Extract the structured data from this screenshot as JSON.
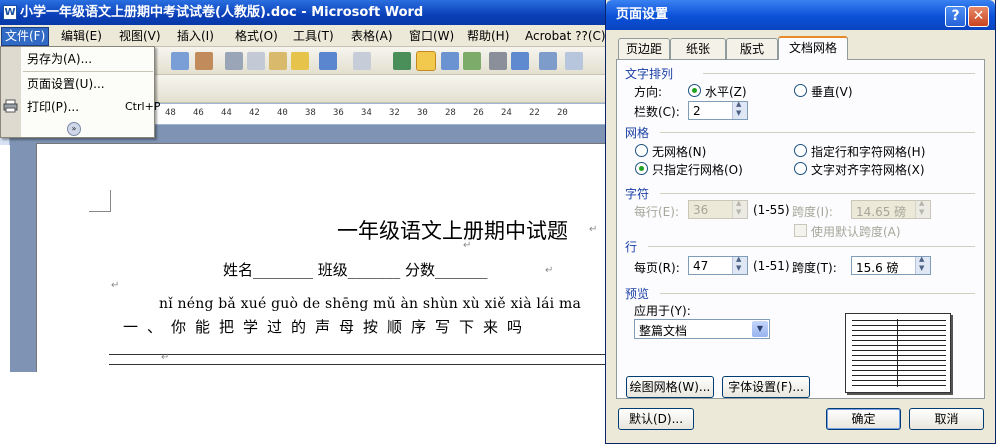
{
  "word": {
    "title": "小学一年级语文上册期中考试试卷(人教版).doc - Microsoft Word",
    "menus": [
      "文件(F)",
      "编辑(E)",
      "视图(V)",
      "插入(I)",
      "格式(O)",
      "工具(T)",
      "表格(A)",
      "窗口(W)",
      "帮助(H)",
      "Acrobat ??(C)"
    ],
    "file_menu": {
      "items": [
        {
          "label": "另存为(A)...",
          "shortcut": ""
        },
        {
          "label": "页面设置(U)...",
          "shortcut": ""
        },
        {
          "label": "打印(P)...",
          "shortcut": "Ctrl+P"
        }
      ],
      "expand_glyph": "»"
    },
    "ruler_numbers": [
      "48",
      "46",
      "44",
      "42",
      "40",
      "38",
      "36",
      "34",
      "32",
      "30",
      "28",
      "26",
      "24",
      "22",
      "20"
    ],
    "document": {
      "heading": "一年级语文上册期中试题",
      "info_line": "姓名________ 班级_______ 分数_______",
      "pinyin_line": "nǐ néng bǎ xué guò de shēng mǔ àn shùn xù xiě xià lái ma",
      "question_1": "一、你能把学过的声母按顺序写下来吗",
      "para_mark": "↵"
    }
  },
  "dialog": {
    "title": "页面设置",
    "help_glyph": "?",
    "close_glyph": "✕",
    "tabs": [
      "页边距",
      "纸张",
      "版式",
      "文档网格"
    ],
    "text_direction": {
      "label": "文字排列",
      "direction_label": "方向:",
      "horizontal": "水平(Z)",
      "vertical": "垂直(V)",
      "columns_label": "栏数(C):",
      "columns_value": "2"
    },
    "grid": {
      "label": "网格",
      "no_grid": "无网格(N)",
      "line_and_char": "指定行和字符网格(H)",
      "line_only": "只指定行网格(O)",
      "snap_to_char": "文字对齐字符网格(X)"
    },
    "characters": {
      "label": "字符",
      "per_line_label": "每行(E):",
      "per_line_value": "36",
      "per_line_range": "(1-55)",
      "pitch_label": "跨度(I):",
      "pitch_value": "14.65 磅",
      "default_pitch": "使用默认跨度(A)"
    },
    "lines": {
      "label": "行",
      "per_page_label": "每页(R):",
      "per_page_value": "47",
      "per_page_range": "(1-51)",
      "pitch_label": "跨度(T):",
      "pitch_value": "15.6 磅"
    },
    "preview": {
      "label": "预览",
      "apply_to_label": "应用于(Y):",
      "apply_to_value": "整篇文档"
    },
    "buttons": {
      "draw_grid": "绘图网格(W)...",
      "font_settings": "字体设置(F)...",
      "default": "默认(D)...",
      "ok": "确定",
      "cancel": "取消"
    }
  }
}
